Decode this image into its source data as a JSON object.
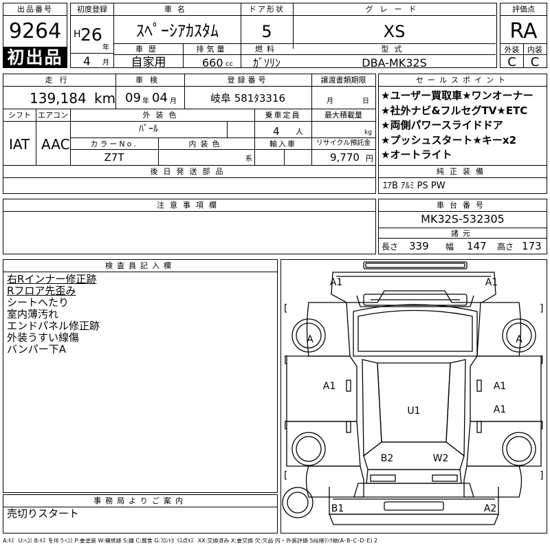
{
  "header": {
    "lot_label": "出品番号",
    "lot_number": "9264",
    "first_listing": "初出品",
    "first_reg_label": "初度登録",
    "era": "H",
    "year": "26",
    "year_unit": "年",
    "month": "4",
    "month_unit": "月",
    "name_label": "車名",
    "car_name": "ｽﾍﾟｰｼｱｶｽﾀﾑ",
    "doors_label": "ドア形状",
    "doors": "5",
    "grade_label": "グレード",
    "grade": "XS",
    "score_label": "評価点",
    "score": "RA",
    "history_label": "車歴",
    "history": "自家用",
    "displacement_label": "排気量",
    "displacement": "660",
    "displacement_unit": "cc",
    "fuel_label": "燃料",
    "fuel": "ｶﾞｿﾘﾝ",
    "model_label": "型式",
    "model": "DBA-MK32S",
    "exterior_label": "外装",
    "exterior_grade": "C",
    "interior_label": "内装",
    "interior_grade": "C"
  },
  "row2": {
    "mileage_label": "走行",
    "mileage": "139,184",
    "mileage_unit": "km",
    "inspection_label": "車検",
    "insp_year": "09",
    "insp_year_unit": "年",
    "insp_month": "04",
    "insp_month_unit": "月",
    "plate_label": "登録番号",
    "plate": "岐阜 581ﾀ3316",
    "transfer_label": "譲渡書類期限",
    "transfer_month_unit": "月",
    "transfer_day_unit": "日"
  },
  "row3": {
    "shift_label": "シフト",
    "shift": "IAT",
    "ac_label": "エアコン",
    "ac": "AAC",
    "ext_color_label": "外装色",
    "ext_color": "ﾊﾟｰﾙ",
    "capacity_label": "乗車定員",
    "capacity": "4",
    "capacity_unit": "人",
    "load_label": "最大積載量",
    "load_unit": "kg",
    "color_no_label": "カラーNo.",
    "color_no": "Z7T",
    "int_color_label": "内装色",
    "int_color_suffix": "系",
    "import_label": "輸入車",
    "recycle_label": "リサイクル預託金",
    "recycle": "9,770",
    "recycle_unit": "円"
  },
  "sales_points": {
    "label": "セールスポイント",
    "items": [
      "★ユーザー買取車★ワンオーナー",
      "★社外ナビ&フルセグTV★ETC",
      "★両側パワースライドドア",
      "★プッシュスタート★キーx2",
      "★オートライト"
    ]
  },
  "later_parts_label": "後日発送部品",
  "standard_equipment": {
    "label": "純正装備",
    "value": "ｴｱB ｱﾙﾐ PS PW"
  },
  "notes_label": "注意事項欄",
  "chassis": {
    "label": "車台番号",
    "value": "MK32S-532305"
  },
  "dimensions": {
    "label": "諸元",
    "length_label": "長さ",
    "length": "339",
    "width_label": "幅",
    "width": "147",
    "height_label": "高さ",
    "height": "173"
  },
  "inspector": {
    "label": "検査員記入欄",
    "lines": [
      "右Rインナー修正跡",
      "Rフロア先歪み",
      "シートへたり",
      "室内薄汚れ",
      "エンドパネル修正跡",
      "外装うすい線傷",
      "バンパー下A"
    ]
  },
  "office": {
    "label": "事務局よりご案内",
    "text": "売切りスタート"
  },
  "diagram_marks": [
    "A1",
    "A1",
    "A",
    "A",
    "A1",
    "A1",
    "U1",
    "A1",
    "B2",
    "W2",
    "B1",
    "A2"
  ],
  "footer": "A:ｷｽﾞ U:ﾍｺﾐ B:ｷｽﾞを伴うﾍｺﾐ P:要塗装 W:補修跡 S:錆 C:腐食 G:ﾌﾛﾝﾄｶﾞﾗｽ点ｷｽﾞ XX:交換済み X:要交換 欠:欠品 内・外装評価 5段階ﾗﾝｸ順(A･B･C･D･E) 2"
}
